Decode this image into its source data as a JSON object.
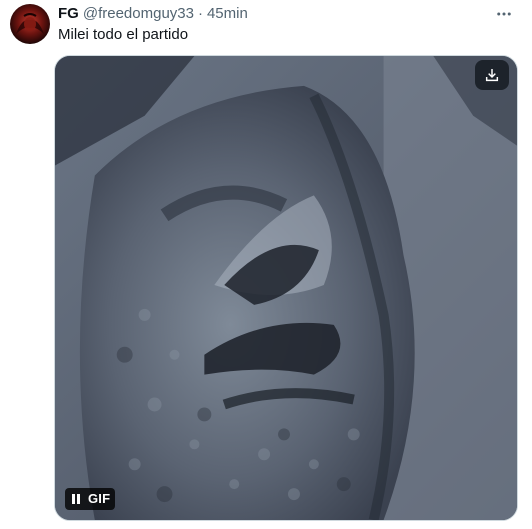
{
  "post": {
    "author_name": "FG",
    "author_handle": "@freedomguy33",
    "separator": "·",
    "timestamp": "45min",
    "text": "Milei todo el partido"
  },
  "media": {
    "type": "gif",
    "badge_label": "GIF",
    "controls": {
      "pause_icon": "pause-icon",
      "download_icon": "download-icon"
    }
  },
  "icons": {
    "more": "more-horizontal-icon",
    "avatar": "avatar"
  },
  "colors": {
    "text_primary": "#0f1419",
    "text_secondary": "#536471",
    "media_overlay": "#0f1419"
  }
}
